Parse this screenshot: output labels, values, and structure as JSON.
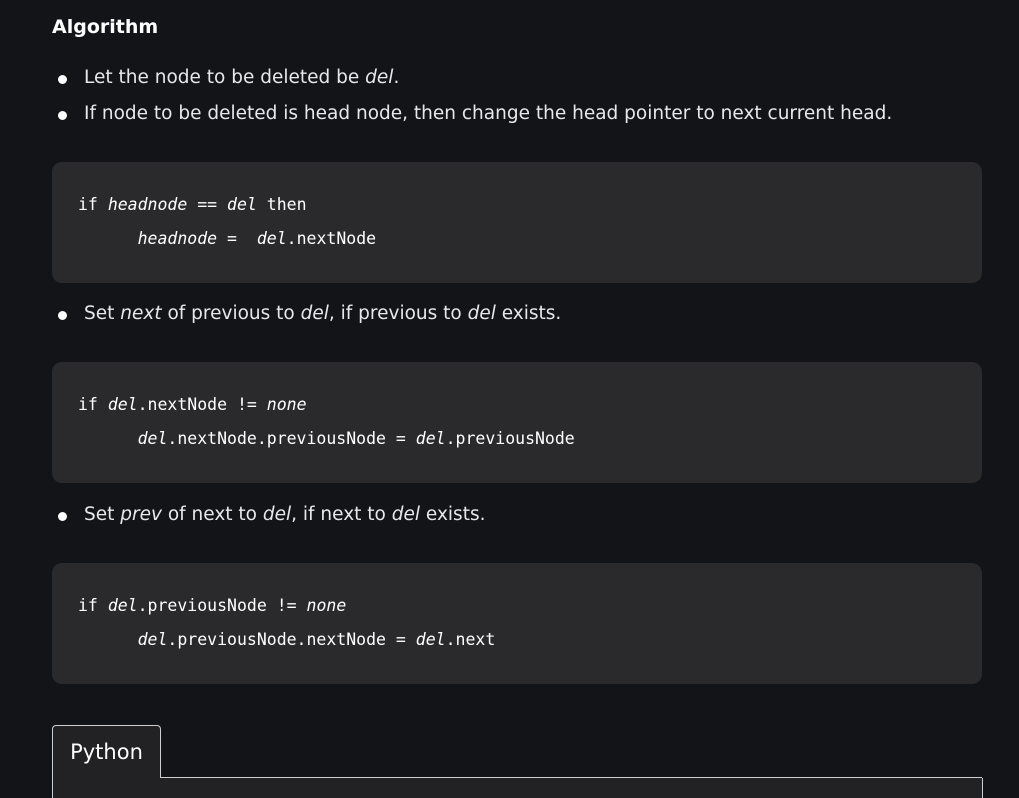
{
  "heading": "Algorithm",
  "bullets1": [
    [
      {
        "t": "Let the node to be deleted be "
      },
      {
        "t": "del",
        "i": true
      },
      {
        "t": "."
      }
    ],
    [
      {
        "t": "If node to be deleted is head node, then change the head pointer to next current head."
      }
    ]
  ],
  "bullet2": [
    {
      "t": "Set "
    },
    {
      "t": "next",
      "i": true
    },
    {
      "t": " of previous to "
    },
    {
      "t": "del",
      "i": true
    },
    {
      "t": ", if previous to "
    },
    {
      "t": "del",
      "i": true
    },
    {
      "t": " exists."
    }
  ],
  "bullet3": [
    {
      "t": "Set "
    },
    {
      "t": "prev",
      "i": true
    },
    {
      "t": " of next to "
    },
    {
      "t": "del",
      "i": true
    },
    {
      "t": ", if next to "
    },
    {
      "t": "del",
      "i": true
    },
    {
      "t": " exists."
    }
  ],
  "code_blocks": [
    [
      [
        {
          "t": "if "
        },
        {
          "t": "headnode",
          "i": true
        },
        {
          "t": " == "
        },
        {
          "t": "del",
          "i": true
        },
        {
          "t": " then"
        }
      ],
      [
        {
          "t": "      "
        },
        {
          "t": "headnode",
          "i": true
        },
        {
          "t": " =  "
        },
        {
          "t": "del",
          "i": true
        },
        {
          "t": ".nextNode"
        }
      ]
    ],
    [
      [
        {
          "t": "if "
        },
        {
          "t": "del",
          "i": true
        },
        {
          "t": ".nextNode != "
        },
        {
          "t": "none",
          "i": true
        }
      ],
      [
        {
          "t": "      "
        },
        {
          "t": "del",
          "i": true
        },
        {
          "t": ".nextNode.previousNode = "
        },
        {
          "t": "del",
          "i": true
        },
        {
          "t": ".previousNode"
        }
      ]
    ],
    [
      [
        {
          "t": "if "
        },
        {
          "t": "del",
          "i": true
        },
        {
          "t": ".previousNode != "
        },
        {
          "t": "none",
          "i": true
        }
      ],
      [
        {
          "t": "      "
        },
        {
          "t": "del",
          "i": true
        },
        {
          "t": ".previousNode.nextNode = "
        },
        {
          "t": "del",
          "i": true
        },
        {
          "t": ".next"
        }
      ]
    ]
  ],
  "tabs": [
    {
      "label": "Python"
    }
  ]
}
